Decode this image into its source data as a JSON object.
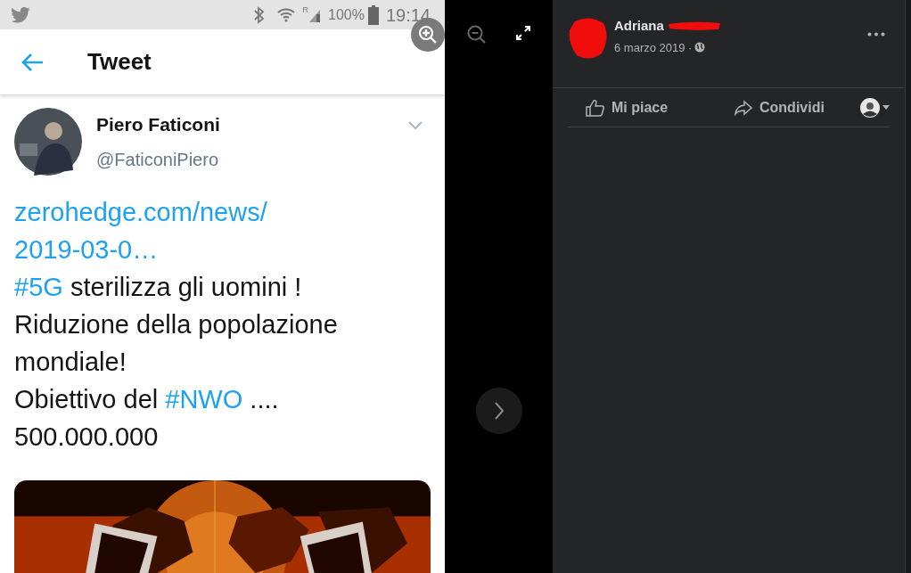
{
  "status_bar": {
    "signal_label": "R",
    "battery": "100%",
    "time": "19:14"
  },
  "header": {
    "title": "Tweet"
  },
  "tweet": {
    "author": "Piero Faticoni",
    "handle": "@FaticoniPiero",
    "lines": [
      [
        {
          "kind": "link",
          "text": "zerohedge.com/news/"
        }
      ],
      [
        {
          "kind": "link",
          "text": "2019-03-0…"
        }
      ],
      [
        {
          "kind": "link",
          "text": "#5G"
        },
        {
          "kind": "plain",
          "text": " sterilizza gli uomini !"
        }
      ],
      [
        {
          "kind": "plain",
          "text": "Riduzione della popolazione"
        }
      ],
      [
        {
          "kind": "plain",
          "text": "mondiale!"
        }
      ],
      [
        {
          "kind": "plain",
          "text": "Obiettivo del "
        },
        {
          "kind": "link",
          "text": "#NWO"
        },
        {
          "kind": "plain",
          "text": " ...."
        }
      ],
      [
        {
          "kind": "plain",
          "text": "500.000.000"
        }
      ]
    ],
    "media": {
      "kind": "picture"
    }
  },
  "post": {
    "author": "Adriana",
    "date": "6 marzo 2019 ·",
    "actions": [
      {
        "kind": "like",
        "label": "Mi piace"
      },
      {
        "kind": "share",
        "label": "Condividi"
      }
    ]
  }
}
